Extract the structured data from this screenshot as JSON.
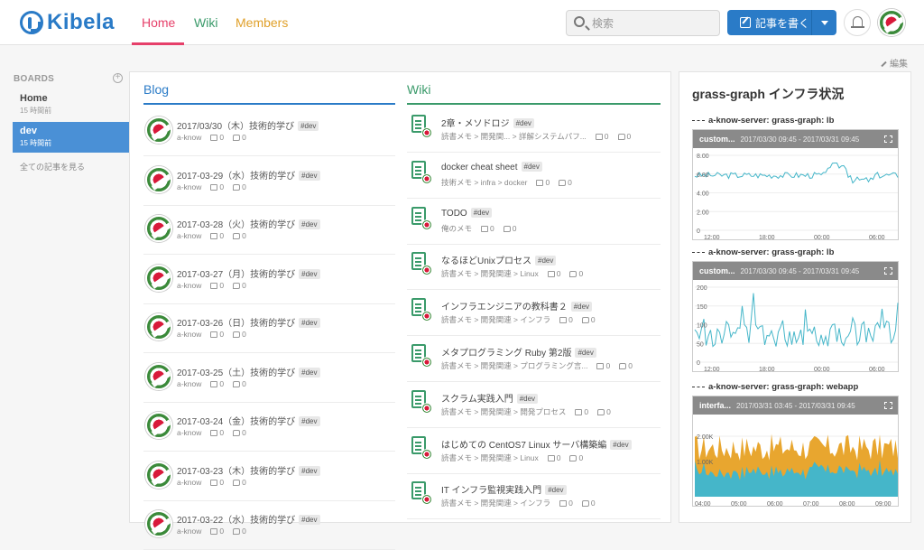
{
  "header": {
    "logo": "Kibela",
    "nav": {
      "home": "Home",
      "wiki": "Wiki",
      "members": "Members"
    },
    "search_placeholder": "検索",
    "write_button": "記事を書く"
  },
  "edit_link": "編集",
  "sidebar": {
    "title": "BOARDS",
    "boards": [
      {
        "name": "Home",
        "time": "15 時間前"
      },
      {
        "name": "dev",
        "time": "15 時間前"
      }
    ],
    "all_posts": "全ての記事を見る"
  },
  "blog": {
    "heading": "Blog",
    "items": [
      {
        "title": "2017/03/30（木）技術的学び",
        "tag": "#dev",
        "author": "a-know",
        "likes": "0",
        "comments": "0"
      },
      {
        "title": "2017-03-29（水）技術的学び",
        "tag": "#dev",
        "author": "a-know",
        "likes": "0",
        "comments": "0"
      },
      {
        "title": "2017-03-28（火）技術的学び",
        "tag": "#dev",
        "author": "a-know",
        "likes": "0",
        "comments": "0"
      },
      {
        "title": "2017-03-27（月）技術的学び",
        "tag": "#dev",
        "author": "a-know",
        "likes": "0",
        "comments": "0"
      },
      {
        "title": "2017-03-26（日）技術的学び",
        "tag": "#dev",
        "author": "a-know",
        "likes": "0",
        "comments": "0"
      },
      {
        "title": "2017-03-25（土）技術的学び",
        "tag": "#dev",
        "author": "a-know",
        "likes": "0",
        "comments": "0"
      },
      {
        "title": "2017-03-24（金）技術的学び",
        "tag": "#dev",
        "author": "a-know",
        "likes": "0",
        "comments": "0"
      },
      {
        "title": "2017-03-23（木）技術的学び",
        "tag": "#dev",
        "author": "a-know",
        "likes": "0",
        "comments": "0"
      },
      {
        "title": "2017-03-22（水）技術的学び",
        "tag": "#dev",
        "author": "a-know",
        "likes": "0",
        "comments": "0"
      }
    ]
  },
  "wiki": {
    "heading": "Wiki",
    "items": [
      {
        "title": "2章・メソドロジ",
        "tag": "#dev",
        "path": "読書メモ > 開発関... > 詳解システムパフ...",
        "likes": "0",
        "comments": "0"
      },
      {
        "title": "docker cheat sheet",
        "tag": "#dev",
        "path": "技術メモ > infra > docker",
        "likes": "0",
        "comments": "0"
      },
      {
        "title": "TODO",
        "tag": "#dev",
        "path": "俺のメモ",
        "likes": "0",
        "comments": "0"
      },
      {
        "title": "なるほどUnixプロセス",
        "tag": "#dev",
        "path": "読書メモ > 開発関連 > Linux",
        "likes": "0",
        "comments": "0"
      },
      {
        "title": "インフラエンジニアの教科書２",
        "tag": "#dev",
        "path": "読書メモ > 開発関連 > インフラ",
        "likes": "0",
        "comments": "0"
      },
      {
        "title": "メタプログラミング Ruby 第2版",
        "tag": "#dev",
        "path": "読書メモ > 開発関連 > プログラミング言...",
        "likes": "0",
        "comments": "0"
      },
      {
        "title": "スクラム実践入門",
        "tag": "#dev",
        "path": "読書メモ > 開発関連 > 開発プロセス",
        "likes": "0",
        "comments": "0"
      },
      {
        "title": "はじめての CentOS7 Linux サーバ構築編",
        "tag": "#dev",
        "path": "読書メモ > 開発関連 > Linux",
        "likes": "0",
        "comments": "0"
      },
      {
        "title": "IT インフラ監視実践入門",
        "tag": "#dev",
        "path": "読書メモ > 開発関連 > インフラ",
        "likes": "0",
        "comments": "0"
      }
    ]
  },
  "right_panel": {
    "title": "grass-graph インフラ状況",
    "graphs": [
      {
        "label": "a-know-server: grass-graph: lb",
        "name": "custom...",
        "range": "2017/03/30 09:45 - 2017/03/31 09:45",
        "yticks": [
          "8.00",
          "6.00",
          "4.00",
          "2.00",
          "0"
        ],
        "xticks": [
          "12:00",
          "18:00",
          "00:00",
          "06:00"
        ],
        "color": "#45b6c9"
      },
      {
        "label": "a-know-server: grass-graph: lb",
        "name": "custom...",
        "range": "2017/03/30 09:45 - 2017/03/31 09:45",
        "yticks": [
          "200",
          "150",
          "100",
          "50",
          "0"
        ],
        "xticks": [
          "12:00",
          "18:00",
          "00:00",
          "06:00"
        ],
        "color": "#45b6c9"
      },
      {
        "label": "a-know-server: grass-graph: webapp",
        "name": "interfa...",
        "range": "2017/03/31 03:45 - 2017/03/31 09:45",
        "yticks": [
          "2.00K",
          "1.00K"
        ],
        "xticks": [
          "04:00",
          "05:00",
          "06:00",
          "07:00",
          "08:00",
          "09:00"
        ],
        "color": "#e8a62f",
        "color2": "#45b6c9"
      }
    ]
  }
}
